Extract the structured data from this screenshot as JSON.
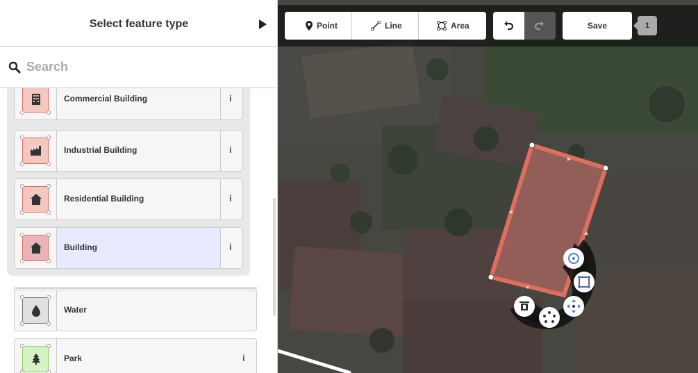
{
  "sidebar": {
    "title": "Select feature type",
    "collapse_icon": "play-right-icon",
    "search": {
      "placeholder": "Search",
      "value": "",
      "icon": "search-icon"
    },
    "group_presets": [
      {
        "label": "Commercial Building",
        "icon": "office-building-icon",
        "color": "#e06e5f",
        "selected": false
      },
      {
        "label": "Industrial Building",
        "icon": "factory-icon",
        "color": "#e06e5f",
        "selected": false
      },
      {
        "label": "Residential Building",
        "icon": "house-icon",
        "color": "#e06e5f",
        "selected": false
      },
      {
        "label": "Building",
        "icon": "house-icon",
        "color": "#e06e5f",
        "selected": true
      }
    ],
    "presets": [
      {
        "label": "Water",
        "icon": "water-drop-icon",
        "color": "#777777"
      },
      {
        "label": "Park",
        "icon": "tree-icon",
        "color": "#8cd05f"
      }
    ],
    "info_label": "i"
  },
  "toolbar": {
    "point_label": "Point",
    "line_label": "Line",
    "area_label": "Area",
    "undo_icon": "undo-icon",
    "redo_icon": "redo-icon",
    "save_label": "Save",
    "edit_count": "1"
  },
  "edit_menu": {
    "items": [
      "circularize-icon",
      "square-icon",
      "move-icon",
      "delete-icon",
      "orthogonalize-icon"
    ]
  },
  "colors": {
    "area_stroke": "#e06e5f",
    "selected_preset_bg": "#e8ebff",
    "selection_halo": "#ffffff"
  }
}
